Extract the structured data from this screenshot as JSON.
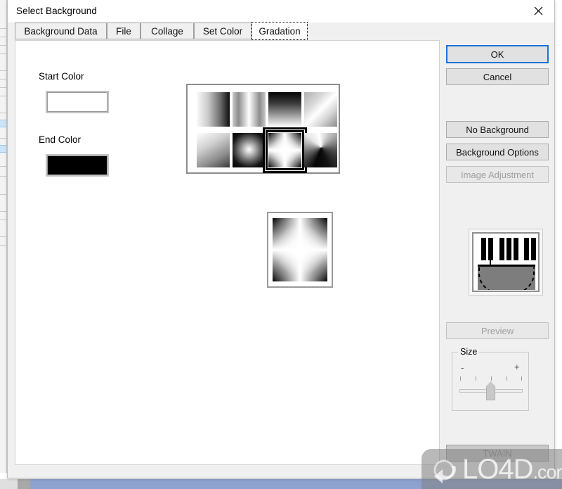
{
  "window": {
    "title": "Select Background",
    "close_icon": "close-icon"
  },
  "tabs": [
    {
      "label": "Background Data",
      "selected": false
    },
    {
      "label": "File",
      "selected": false
    },
    {
      "label": "Collage",
      "selected": false
    },
    {
      "label": "Set Color",
      "selected": false
    },
    {
      "label": "Gradation",
      "selected": true
    }
  ],
  "gradation": {
    "start_color_label": "Start Color",
    "start_color_value": "#ffffff",
    "end_color_label": "End Color",
    "end_color_value": "#000000",
    "patterns": [
      {
        "name": "linear-horizontal-left-light",
        "selected": false
      },
      {
        "name": "linear-mirror-horizontal",
        "selected": false
      },
      {
        "name": "linear-vertical-dark-top",
        "selected": false
      },
      {
        "name": "linear-diagonal",
        "selected": false
      },
      {
        "name": "linear-diagonal-corner",
        "selected": false
      },
      {
        "name": "radial-center-burst",
        "selected": false
      },
      {
        "name": "star-cross-burst",
        "selected": true
      },
      {
        "name": "conical-angular",
        "selected": false
      }
    ],
    "preview_pattern": "star-cross-burst"
  },
  "sidebar": {
    "ok_label": "OK",
    "cancel_label": "Cancel",
    "no_background_label": "No Background",
    "background_options_label": "Background Options",
    "image_adjustment_label": "Image Adjustment",
    "image_adjustment_disabled": true,
    "preview_label": "Preview",
    "preview_disabled": true,
    "twain_label": "TWAIN",
    "twain_disabled": true,
    "thumbnail_icon": "piano-keyboard-selection-icon",
    "size": {
      "legend": "Size",
      "minus_label": "-",
      "plus_label": "+",
      "tick_count": 5,
      "value_position_percent": 50
    }
  },
  "watermark": {
    "main_text": "LO4D",
    "suffix_text": ".com",
    "logo_icon": "refresh-cycle-icon"
  },
  "colors": {
    "dialog_bg": "#f0f0f0",
    "accent_focus": "#1a73d4",
    "button_face": "#e1e1e1",
    "disabled_text": "#a0a0a0"
  }
}
